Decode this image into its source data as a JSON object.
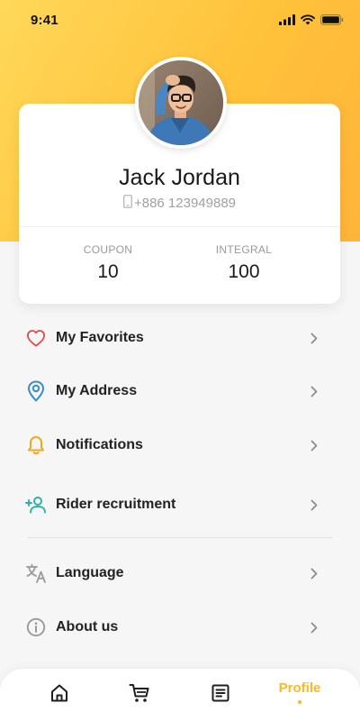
{
  "status_bar": {
    "time": "9:41"
  },
  "profile": {
    "name": "Jack Jordan",
    "phone": "+886 123949889"
  },
  "stats": {
    "coupon": {
      "label": "COUPON",
      "value": "10"
    },
    "integral": {
      "label": "INTEGRAL",
      "value": "100"
    }
  },
  "menu": {
    "favorites": {
      "label": "My Favorites",
      "icon": "heart-icon"
    },
    "address": {
      "label": "My Address",
      "icon": "location-pin-icon"
    },
    "notifications": {
      "label": "Notifications",
      "icon": "bell-icon"
    },
    "rider": {
      "label": "Rider recruitment",
      "icon": "add-person-icon"
    },
    "language": {
      "label": "Language",
      "icon": "translate-icon"
    },
    "about": {
      "label": "About us",
      "icon": "info-icon"
    }
  },
  "bottom_nav": {
    "home_icon": "home-icon",
    "cart_icon": "cart-icon",
    "orders_icon": "orders-icon",
    "profile_label": "Profile",
    "active": "profile"
  },
  "colors": {
    "accent": "#ffb820",
    "hero_start": "#ffd85a",
    "hero_end": "#ffb43a",
    "favorites_icon": "#e04b4b",
    "address_icon": "#3a8dc9",
    "notifications_icon": "#f0a818",
    "rider_icon": "#2bb3a1",
    "muted_icon": "#9a9a9a"
  }
}
